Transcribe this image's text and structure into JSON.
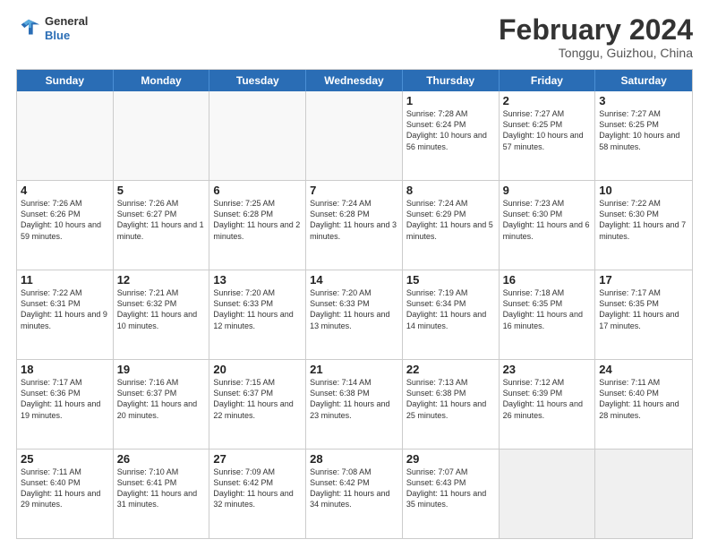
{
  "header": {
    "logo_line1": "General",
    "logo_line2": "Blue",
    "title": "February 2024",
    "location": "Tonggu, Guizhou, China"
  },
  "days_of_week": [
    "Sunday",
    "Monday",
    "Tuesday",
    "Wednesday",
    "Thursday",
    "Friday",
    "Saturday"
  ],
  "weeks": [
    [
      {
        "day": "",
        "info": "",
        "empty": true
      },
      {
        "day": "",
        "info": "",
        "empty": true
      },
      {
        "day": "",
        "info": "",
        "empty": true
      },
      {
        "day": "",
        "info": "",
        "empty": true
      },
      {
        "day": "1",
        "info": "Sunrise: 7:28 AM\nSunset: 6:24 PM\nDaylight: 10 hours and 56 minutes."
      },
      {
        "day": "2",
        "info": "Sunrise: 7:27 AM\nSunset: 6:25 PM\nDaylight: 10 hours and 57 minutes."
      },
      {
        "day": "3",
        "info": "Sunrise: 7:27 AM\nSunset: 6:25 PM\nDaylight: 10 hours and 58 minutes."
      }
    ],
    [
      {
        "day": "4",
        "info": "Sunrise: 7:26 AM\nSunset: 6:26 PM\nDaylight: 10 hours and 59 minutes."
      },
      {
        "day": "5",
        "info": "Sunrise: 7:26 AM\nSunset: 6:27 PM\nDaylight: 11 hours and 1 minute."
      },
      {
        "day": "6",
        "info": "Sunrise: 7:25 AM\nSunset: 6:28 PM\nDaylight: 11 hours and 2 minutes."
      },
      {
        "day": "7",
        "info": "Sunrise: 7:24 AM\nSunset: 6:28 PM\nDaylight: 11 hours and 3 minutes."
      },
      {
        "day": "8",
        "info": "Sunrise: 7:24 AM\nSunset: 6:29 PM\nDaylight: 11 hours and 5 minutes."
      },
      {
        "day": "9",
        "info": "Sunrise: 7:23 AM\nSunset: 6:30 PM\nDaylight: 11 hours and 6 minutes."
      },
      {
        "day": "10",
        "info": "Sunrise: 7:22 AM\nSunset: 6:30 PM\nDaylight: 11 hours and 7 minutes."
      }
    ],
    [
      {
        "day": "11",
        "info": "Sunrise: 7:22 AM\nSunset: 6:31 PM\nDaylight: 11 hours and 9 minutes."
      },
      {
        "day": "12",
        "info": "Sunrise: 7:21 AM\nSunset: 6:32 PM\nDaylight: 11 hours and 10 minutes."
      },
      {
        "day": "13",
        "info": "Sunrise: 7:20 AM\nSunset: 6:33 PM\nDaylight: 11 hours and 12 minutes."
      },
      {
        "day": "14",
        "info": "Sunrise: 7:20 AM\nSunset: 6:33 PM\nDaylight: 11 hours and 13 minutes."
      },
      {
        "day": "15",
        "info": "Sunrise: 7:19 AM\nSunset: 6:34 PM\nDaylight: 11 hours and 14 minutes."
      },
      {
        "day": "16",
        "info": "Sunrise: 7:18 AM\nSunset: 6:35 PM\nDaylight: 11 hours and 16 minutes."
      },
      {
        "day": "17",
        "info": "Sunrise: 7:17 AM\nSunset: 6:35 PM\nDaylight: 11 hours and 17 minutes."
      }
    ],
    [
      {
        "day": "18",
        "info": "Sunrise: 7:17 AM\nSunset: 6:36 PM\nDaylight: 11 hours and 19 minutes."
      },
      {
        "day": "19",
        "info": "Sunrise: 7:16 AM\nSunset: 6:37 PM\nDaylight: 11 hours and 20 minutes."
      },
      {
        "day": "20",
        "info": "Sunrise: 7:15 AM\nSunset: 6:37 PM\nDaylight: 11 hours and 22 minutes."
      },
      {
        "day": "21",
        "info": "Sunrise: 7:14 AM\nSunset: 6:38 PM\nDaylight: 11 hours and 23 minutes."
      },
      {
        "day": "22",
        "info": "Sunrise: 7:13 AM\nSunset: 6:38 PM\nDaylight: 11 hours and 25 minutes."
      },
      {
        "day": "23",
        "info": "Sunrise: 7:12 AM\nSunset: 6:39 PM\nDaylight: 11 hours and 26 minutes."
      },
      {
        "day": "24",
        "info": "Sunrise: 7:11 AM\nSunset: 6:40 PM\nDaylight: 11 hours and 28 minutes."
      }
    ],
    [
      {
        "day": "25",
        "info": "Sunrise: 7:11 AM\nSunset: 6:40 PM\nDaylight: 11 hours and 29 minutes."
      },
      {
        "day": "26",
        "info": "Sunrise: 7:10 AM\nSunset: 6:41 PM\nDaylight: 11 hours and 31 minutes."
      },
      {
        "day": "27",
        "info": "Sunrise: 7:09 AM\nSunset: 6:42 PM\nDaylight: 11 hours and 32 minutes."
      },
      {
        "day": "28",
        "info": "Sunrise: 7:08 AM\nSunset: 6:42 PM\nDaylight: 11 hours and 34 minutes."
      },
      {
        "day": "29",
        "info": "Sunrise: 7:07 AM\nSunset: 6:43 PM\nDaylight: 11 hours and 35 minutes."
      },
      {
        "day": "",
        "info": "",
        "empty": true,
        "shaded": true
      },
      {
        "day": "",
        "info": "",
        "empty": true,
        "shaded": true
      }
    ]
  ]
}
